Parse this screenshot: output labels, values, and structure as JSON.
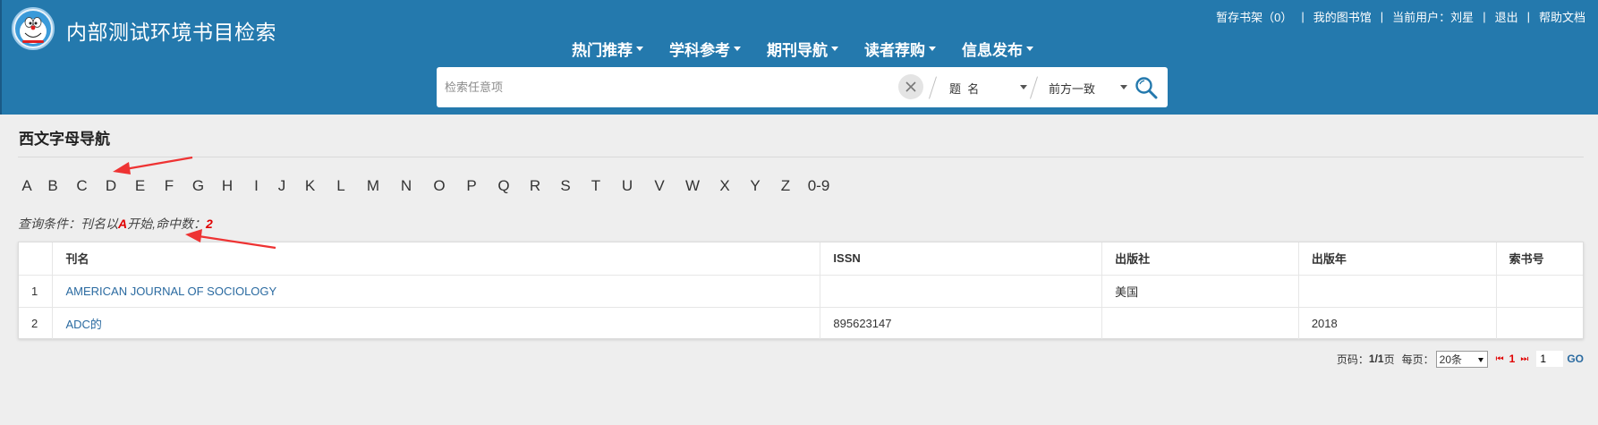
{
  "header": {
    "site_title": "内部测试环境书目检索",
    "topbar": {
      "shelf": "暂存书架（0）",
      "my_library": "我的图书馆",
      "current_user": "当前用户：刘星",
      "logout": "退出",
      "help": "帮助文档"
    },
    "nav": [
      {
        "label": "热门推荐"
      },
      {
        "label": "学科参考"
      },
      {
        "label": "期刊导航"
      },
      {
        "label": "读者荐购"
      },
      {
        "label": "信息发布"
      }
    ]
  },
  "search": {
    "placeholder": "检索任意项",
    "field_select": "题  名",
    "match_select": "前方一致"
  },
  "page": {
    "section_title": "西文字母导航",
    "letters": [
      "A",
      "B",
      "C",
      "D",
      "E",
      "F",
      "G",
      "H",
      "I",
      "J",
      "K",
      "L",
      "M",
      "N",
      "O",
      "P",
      "Q",
      "R",
      "S",
      "T",
      "U",
      "V",
      "W",
      "X",
      "Y",
      "Z",
      "0-9"
    ],
    "query": {
      "prefix": "查询条件：刊名以",
      "letter": "A",
      "middle": "开始,命中数：",
      "count": "2"
    }
  },
  "table": {
    "headers": [
      "",
      "刊名",
      "ISSN",
      "出版社",
      "出版年",
      "索书号"
    ],
    "rows": [
      {
        "num": "1",
        "title": "AMERICAN JOURNAL OF SOCIOLOGY",
        "issn": "",
        "publisher": "美国",
        "year": "",
        "call_no": ""
      },
      {
        "num": "2",
        "title": "ADC的",
        "issn": "895623147",
        "publisher": "",
        "year": "2018",
        "call_no": ""
      }
    ]
  },
  "pager": {
    "page_label": "页码：",
    "page_value": "1/1",
    "page_suffix": "页",
    "per_page_label": "每页：",
    "per_page_value": "20条",
    "current_page": "1",
    "jump_value": "1",
    "go_label": "GO"
  },
  "colors": {
    "header_bg": "#2479ad",
    "link": "#2a6aa0",
    "highlight": "#e00000",
    "annotation_arrow": "#ee3333"
  }
}
